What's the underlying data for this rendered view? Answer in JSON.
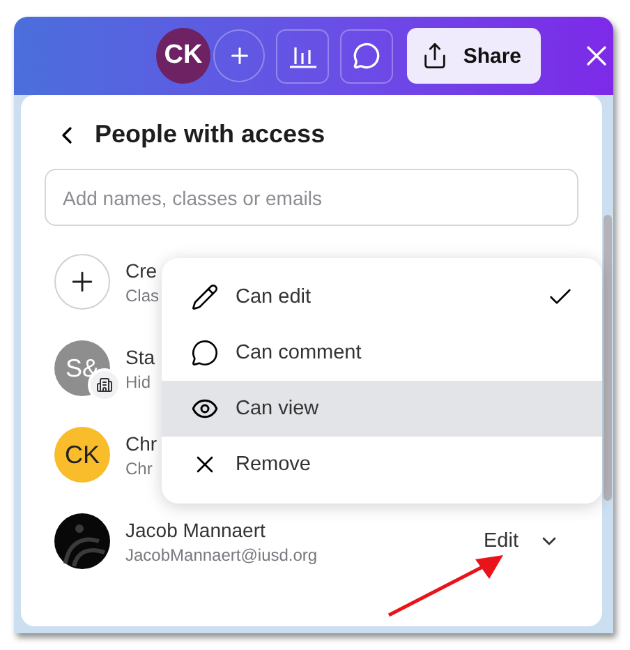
{
  "toolbar": {
    "avatar": "CK",
    "share_label": "Share"
  },
  "panel": {
    "title": "People with access",
    "search": {
      "placeholder": "Add names, classes or emails"
    },
    "people": [
      {
        "kind": "add",
        "name": "Cre",
        "detail": "Clas"
      },
      {
        "kind": "group",
        "initials": "S&",
        "name": "Sta",
        "detail": "Hid"
      },
      {
        "kind": "initials",
        "initials": "CK",
        "color": "#f9bd2b",
        "name": "Chr",
        "detail": "Chr"
      },
      {
        "kind": "photo",
        "name": "Jacob Mannaert",
        "detail": "JacobMannaert@iusd.org",
        "role": "Edit"
      }
    ]
  },
  "menu": {
    "items": [
      {
        "kind": "edit",
        "label": "Can edit",
        "checked": true,
        "highlighted": false
      },
      {
        "kind": "comment",
        "label": "Can comment",
        "checked": false,
        "highlighted": false
      },
      {
        "kind": "view",
        "label": "Can view",
        "checked": false,
        "highlighted": true
      },
      {
        "kind": "remove",
        "label": "Remove",
        "checked": false,
        "highlighted": false
      }
    ]
  }
}
